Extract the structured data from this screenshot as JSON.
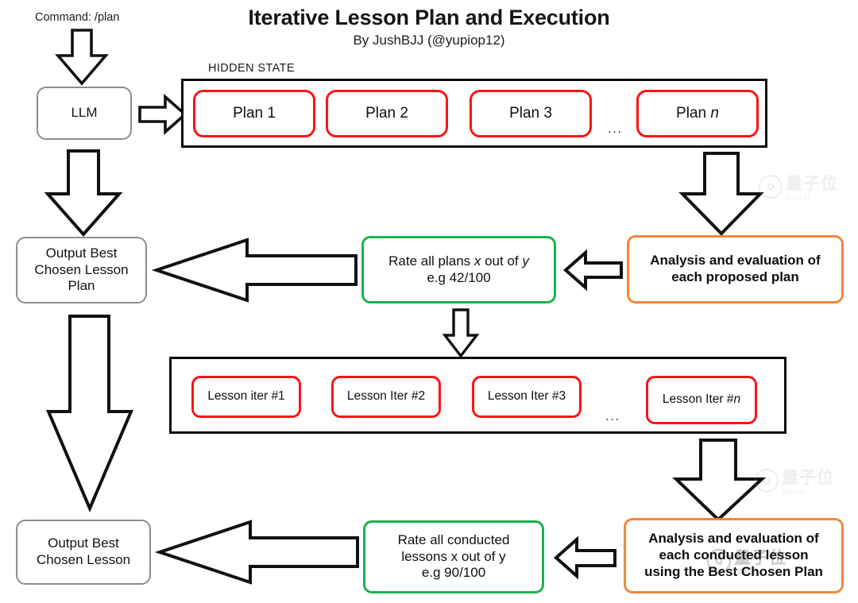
{
  "header": {
    "title": "Iterative Lesson Plan and Execution",
    "subtitle": "By JushBJJ (@yupiop12)"
  },
  "labels": {
    "command": "Command: /plan",
    "hidden_state": "HIDDEN STATE",
    "ellipsis": "..."
  },
  "nodes": {
    "llm": "LLM",
    "output_best_plan": "Output Best\nChosen Lesson\nPlan",
    "output_best_lesson": "Output Best\nChosen Lesson"
  },
  "plans": [
    {
      "label": "Plan 1"
    },
    {
      "label": "Plan 2"
    },
    {
      "label": "Plan 3"
    },
    {
      "label_prefix": "Plan ",
      "label_italic": "n"
    }
  ],
  "lessons": [
    {
      "label": "Lesson iter #1"
    },
    {
      "label": "Lesson Iter #2"
    },
    {
      "label": "Lesson Iter #3"
    },
    {
      "label_prefix": "Lesson Iter #",
      "label_italic": "n"
    }
  ],
  "rate_plans": {
    "line1_a": "Rate all plans ",
    "line1_x": "x",
    "line1_b": " out of ",
    "line1_y": "y",
    "line2": "e.g 42/100"
  },
  "rate_lessons": {
    "line1": "Rate all conducted",
    "line2": "lessons x out of y",
    "line3": "e.g 90/100"
  },
  "analysis_plan": "Analysis and evaluation of\neach proposed plan",
  "analysis_lesson": "Analysis and evaluation of\neach conducted lesson\nusing the Best Chosen Plan",
  "watermark": {
    "cn": "量子位",
    "en": "QbitAI",
    "logo": "Q"
  },
  "colors": {
    "red": "#fb1414",
    "green": "#1ab24b",
    "orange": "#f4873a",
    "gray": "#8d8d8d",
    "black": "#0b0b0b",
    "background": "#ffffff"
  }
}
